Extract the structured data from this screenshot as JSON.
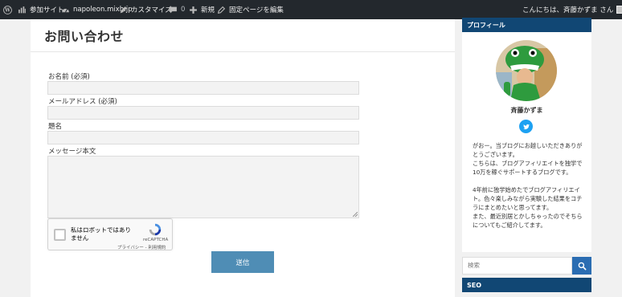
{
  "adminbar": {
    "site_name": "参加サイト",
    "napoleon": "napoleon.mixh.jp",
    "customize": "カスタマイズ",
    "comments_count": "0",
    "new": "新規",
    "fixed_page_edit": "固定ページを編集",
    "howdy": "こんにちは、斉藤かずま さん"
  },
  "page": {
    "title": "お問い合わせ"
  },
  "form": {
    "name_label": "お名前 (必須)",
    "email_label": "メールアドレス (必須)",
    "subject_label": "題名",
    "message_label": "メッセージ本文",
    "recaptcha_text": "私はロボットではありません",
    "recaptcha_brand": "reCAPTCHA",
    "recaptcha_terms": "プライバシー - 利用規約",
    "submit_label": "送信"
  },
  "sidebar": {
    "profile_heading": "プロフィール",
    "profile_name": "斉藤かずま",
    "bio_1": "がおー。当ブログにお越しいただきありがとうございます。\nこちらは、ブログアフィリエイトを独学で10万を稼ぐサポートするブログです。",
    "bio_2": "4年前に独学始めたでブログアフィリエイト。色々楽しみながら実験した結果をコチラにまとめたいと思ってます。\nまた、最近別居とかしちゃったのでそちらについてもご紹介してます。",
    "search_placeholder": "検索",
    "seo_heading": "SEO"
  },
  "colors": {
    "adminbar_bg": "#23282d",
    "widget_header": "#114774",
    "submit_bg": "#4f8db5",
    "search_btn": "#2b6db2",
    "twitter": "#1da1f2"
  },
  "icons": [
    "wordpress-icon",
    "site-icon",
    "gauge-icon",
    "pencil-icon",
    "comment-icon",
    "plus-icon",
    "edit-icon",
    "recaptcha-icon",
    "twitter-icon",
    "search-icon"
  ]
}
